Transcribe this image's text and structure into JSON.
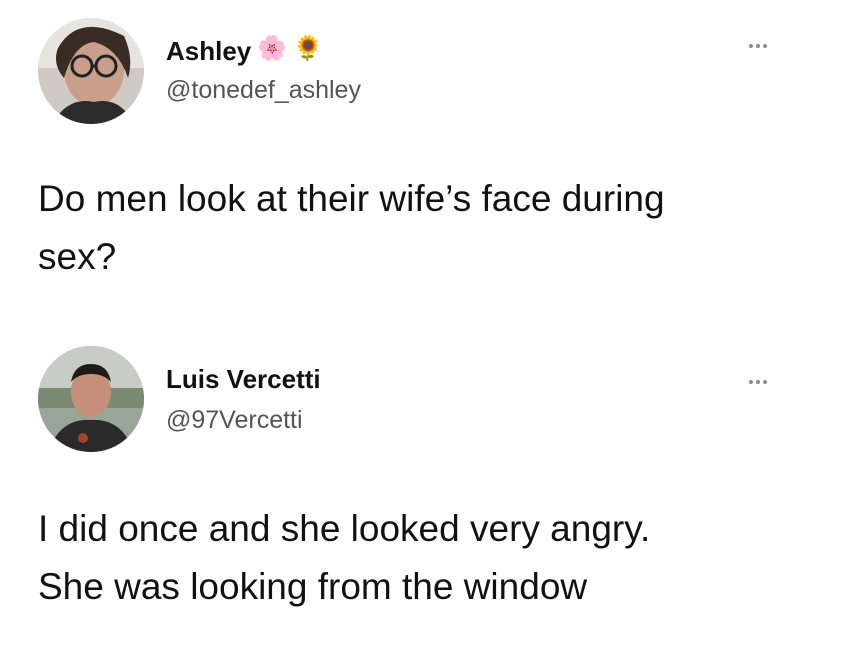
{
  "tweets": [
    {
      "display_name": "Ashley",
      "emojis": [
        "🌸",
        "🌻"
      ],
      "handle": "@tonedef_ashley",
      "text": "Do men look at their wife’s face during\nsex?",
      "more_icon": "more-options-icon"
    },
    {
      "display_name": "Luis Vercetti",
      "emojis": [],
      "handle": "@97Vercetti",
      "text": "I did once and she looked very angry.\nShe was looking from the window",
      "more_icon": "more-options-icon"
    }
  ],
  "colors": {
    "background": "#ffffff",
    "text": "#111111",
    "handle": "#555555",
    "more_dots": "#8a8a8a"
  }
}
